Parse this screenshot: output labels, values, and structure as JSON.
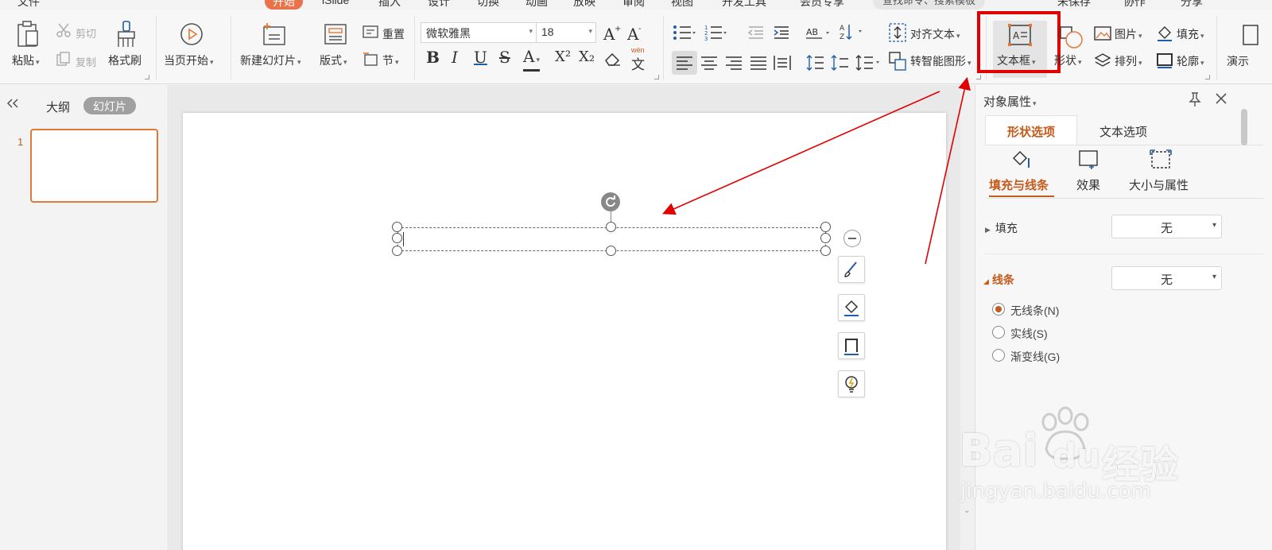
{
  "menu": {
    "file": "文件",
    "tabs": [
      "开始",
      "iSlide",
      "插入",
      "设计",
      "切换",
      "动画",
      "放映",
      "审阅",
      "视图",
      "开发工具",
      "会员专享"
    ],
    "search_placeholder": "查找命令、搜索模板",
    "unsaved": "未保存",
    "collab": "协作",
    "share": "分享"
  },
  "ribbon": {
    "paste": "粘贴",
    "cut": "剪切",
    "copy": "复制",
    "format_painter": "格式刷",
    "from_current": "当页开始",
    "new_slide": "新建幻灯片",
    "layout": "版式",
    "reset": "重置",
    "section": "节",
    "font_name": "微软雅黑",
    "font_size": "18",
    "align_text": "对齐文本",
    "smartart": "转智能图形",
    "textbox": "文本框",
    "shape": "形状",
    "picture": "图片",
    "fill": "填充",
    "arrange": "排列",
    "outline": "轮廓",
    "present_tools": "演示",
    "bold": "B",
    "italic": "I",
    "underline": "U",
    "strike": "S",
    "font_color": "A",
    "superscript": "X²",
    "subscript": "X₂",
    "pinyin": "文",
    "pinyin_top": "wén"
  },
  "left_panel": {
    "outline_tab": "大纲",
    "slides_tab": "幻灯片",
    "slide_number": "1"
  },
  "right_panel": {
    "title": "对象属性",
    "tab_shape": "形状选项",
    "tab_text": "文本选项",
    "sub_fill_line": "填充与线条",
    "sub_effect": "效果",
    "sub_size": "大小与属性",
    "fill_label": "填充",
    "fill_value": "无",
    "line_label": "线条",
    "line_value": "无",
    "radio_none": "无线条(N)",
    "radio_solid": "实线(S)",
    "radio_gradient": "渐变线(G)"
  },
  "watermark": {
    "brand": "Bai",
    "brand2": "du",
    "cn": "经验",
    "url": "jingyan.baidu.com"
  },
  "colors": {
    "accent": "#c55a1b",
    "tab_active_bg": "#e8734a",
    "highlight_red": "#e00000",
    "thumb_border": "#e07a3a"
  }
}
